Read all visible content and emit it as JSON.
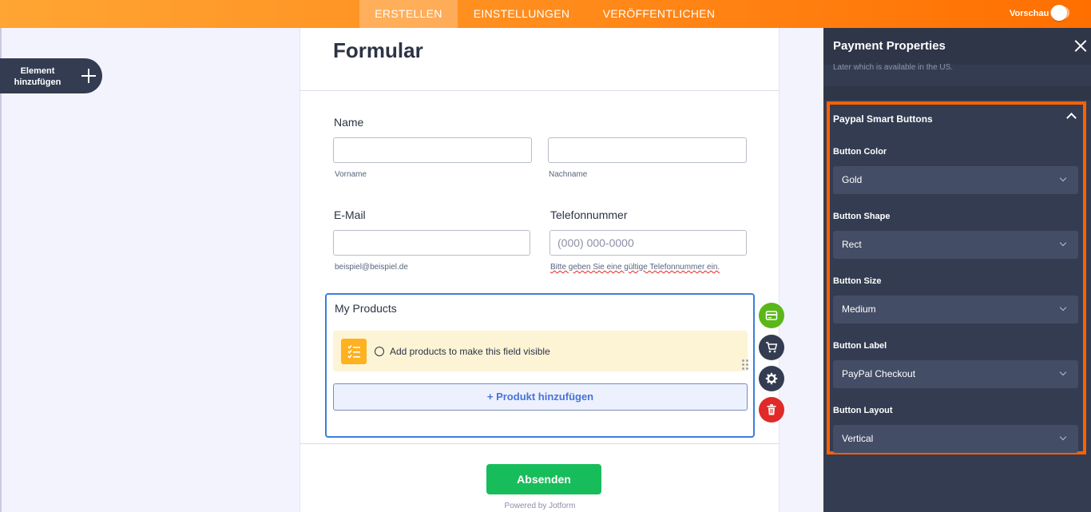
{
  "topbar": {
    "tabs": [
      {
        "label": "ERSTELLEN",
        "active": true
      },
      {
        "label": "EINSTELLUNGEN",
        "active": false
      },
      {
        "label": "VERÖFFENTLICHEN",
        "active": false
      }
    ],
    "preview_label": "Vorschau",
    "preview_enabled": false,
    "accent_color": "#ff6f00"
  },
  "sidebar": {
    "add_element_label": "Element hinzufügen"
  },
  "form": {
    "title": "Formular",
    "name": {
      "label": "Name",
      "first_value": "",
      "last_value": "",
      "first_sublabel": "Vorname",
      "last_sublabel": "Nachname"
    },
    "email": {
      "label": "E-Mail",
      "value": "",
      "sublabel": "beispiel@beispiel.de"
    },
    "phone": {
      "label": "Telefonnummer",
      "placeholder": "(000) 000-0000",
      "sublabel": "Bitte geben Sie eine gültige Telefonnummer ein."
    },
    "products": {
      "label": "My Products",
      "notice": "Add products to make this field visible",
      "add_button": "+ Produkt hinzufügen"
    },
    "side_tools": [
      {
        "icon": "payment-card-icon",
        "color": "#5ab719"
      },
      {
        "icon": "cart-icon",
        "color": "#343c52"
      },
      {
        "icon": "gear-icon",
        "color": "#343c52"
      },
      {
        "icon": "trash-icon",
        "color": "#e02929"
      }
    ],
    "submit_label": "Absenden",
    "submit_color": "#18bd5b",
    "powered_by": "Powered by Jotform"
  },
  "panel": {
    "title": "Payment Properties",
    "clipped_text": "Later which is available in the US.",
    "section_title": "Paypal Smart Buttons",
    "highlight_color": "#ff6100",
    "properties": [
      {
        "label": "Button Color",
        "value": "Gold"
      },
      {
        "label": "Button Shape",
        "value": "Rect"
      },
      {
        "label": "Button Size",
        "value": "Medium"
      },
      {
        "label": "Button Label",
        "value": "PayPal Checkout"
      },
      {
        "label": "Button Layout",
        "value": "Vertical"
      }
    ]
  }
}
